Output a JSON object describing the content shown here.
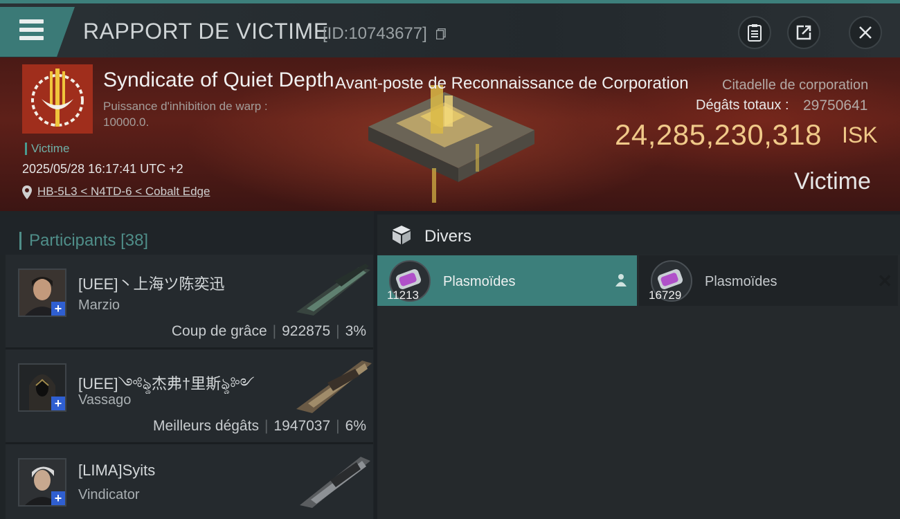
{
  "header": {
    "title": "RAPPORT DE VICTIME",
    "id_text": "[ID:10743677]"
  },
  "victim": {
    "corporation": "Syndicate of Quiet Depth",
    "warp_label": "Puissance d'inhibition de warp :",
    "warp_value": "10000.0.",
    "role_tag": "Victime",
    "datetime": "2025/05/28 16:17:41 UTC +2",
    "location": "HB-5L3 < N4TD-6 < Cobalt Edge",
    "ship_name": "Avant-poste de Reconnaissance de Corporation",
    "ship_class": "Citadelle de corporation",
    "damage_label": "Dégâts totaux :",
    "damage_value": "29750641",
    "isk_value": "24,285,230,318",
    "isk_unit": "ISK",
    "status": "Victime"
  },
  "participants": {
    "title": "Participants",
    "count": "[38]",
    "rows": [
      {
        "name": "[UEE]丶上海ツ陈奕迅",
        "ship": "Marzio",
        "label": "Coup de grâce",
        "damage": "922875",
        "percent": "3%"
      },
      {
        "name": "[UEE]༺ৡ杰弗†里斯ৡ༻",
        "ship": "Vassago",
        "label": "Meilleurs dégâts",
        "damage": "1947037",
        "percent": "6%"
      },
      {
        "name": "[LIMA]Syits",
        "ship": "Vindicator",
        "label": "",
        "damage": "",
        "percent": ""
      }
    ]
  },
  "divers": {
    "title": "Divers",
    "items": [
      {
        "name": "Plasmoïdes",
        "qty": "11213",
        "selected": true
      },
      {
        "name": "Plasmoïdes",
        "qty": "16729",
        "selected": false
      }
    ]
  },
  "colors": {
    "accent": "#3c7f7b",
    "isk": "#f0c989",
    "banner": "#5e2019"
  }
}
